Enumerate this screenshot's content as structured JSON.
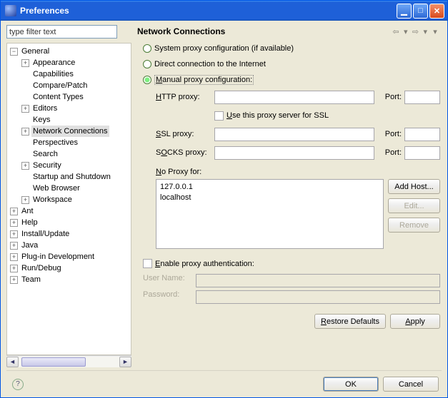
{
  "title": "Preferences",
  "filter_placeholder": "type filter text",
  "tree": {
    "general": "General",
    "appearance": "Appearance",
    "capabilities": "Capabilities",
    "compare_patch": "Compare/Patch",
    "content_types": "Content Types",
    "editors": "Editors",
    "keys": "Keys",
    "network_connections": "Network Connections",
    "perspectives": "Perspectives",
    "search": "Search",
    "security": "Security",
    "startup_shutdown": "Startup and Shutdown",
    "web_browser": "Web Browser",
    "workspace": "Workspace",
    "ant": "Ant",
    "help": "Help",
    "install_update": "Install/Update",
    "java": "Java",
    "plugin_dev": "Plug-in Development",
    "run_debug": "Run/Debug",
    "team": "Team"
  },
  "page": {
    "title": "Network Connections",
    "radio_system": "System proxy configuration (if available)",
    "radio_direct": "Direct connection to the Internet",
    "radio_manual": "Manual proxy configuration:",
    "http_proxy_label": "HTTP proxy:",
    "port_label": "Port:",
    "use_for_ssl": "Use this proxy server for SSL",
    "ssl_proxy_label": "SSL proxy:",
    "socks_proxy_label": "SOCKS proxy:",
    "no_proxy_label": "No Proxy for:",
    "no_proxy_items": [
      "127.0.0.1",
      "localhost"
    ],
    "add_host": "Add Host...",
    "edit": "Edit...",
    "remove": "Remove",
    "enable_auth": "Enable proxy authentication:",
    "user_name_label": "User Name:",
    "password_label": "Password:",
    "restore_defaults": "Restore Defaults",
    "apply": "Apply",
    "ok": "OK",
    "cancel": "Cancel",
    "values": {
      "http_proxy": "",
      "http_port": "",
      "ssl_proxy": "",
      "ssl_port": "",
      "socks_proxy": "",
      "socks_port": "",
      "user_name": "",
      "password": ""
    }
  }
}
